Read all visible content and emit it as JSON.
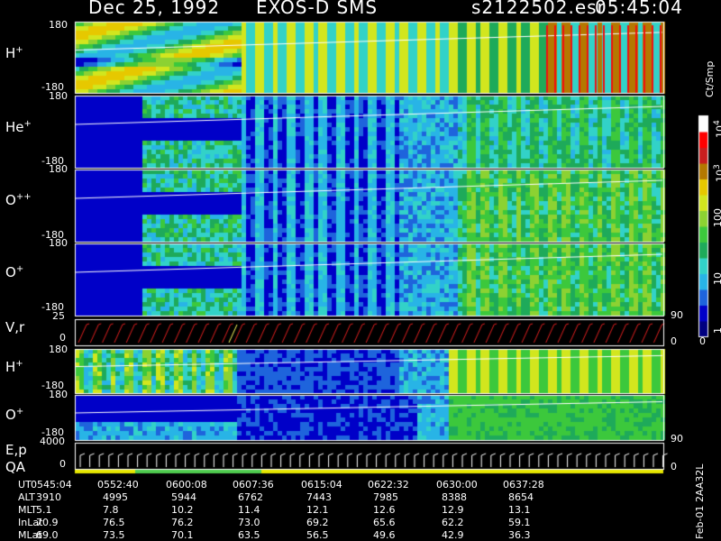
{
  "header": {
    "date": "Dec 25, 1992",
    "instrument": "EXOS-D SMS",
    "filename": "s2122502.esr",
    "time": "05:45:04"
  },
  "colorbar": {
    "unit": "Ct/Smp",
    "ticks": [
      "10",
      "100",
      "1",
      "10",
      "10",
      "1"
    ],
    "exponents": {
      "t3": "3",
      "t4": "4"
    },
    "scale": "log",
    "colors": [
      "#000080",
      "#0000c8",
      "#1e64dc",
      "#28b4e6",
      "#32d2c8",
      "#1eaa5a",
      "#3cc83c",
      "#8cd232",
      "#d2e61e",
      "#e6c800",
      "#b47800",
      "#c81e1e",
      "#ff0000",
      "#ffffff"
    ]
  },
  "footer": {
    "code": "Feb-01 2AA32L"
  },
  "chart_data": [
    {
      "type": "heatmap",
      "species": "H",
      "charge": "+",
      "yticks": [
        "180",
        "-180"
      ],
      "note": "pitch angle vs time"
    },
    {
      "type": "heatmap",
      "species": "He",
      "charge": "+",
      "yticks": [
        "180",
        "-180"
      ]
    },
    {
      "type": "heatmap",
      "species": "O",
      "charge": "++",
      "yticks": [
        "180",
        "-180"
      ]
    },
    {
      "type": "heatmap",
      "species": "O",
      "charge": "+",
      "yticks": [
        "180",
        "-180"
      ]
    },
    {
      "type": "line",
      "label": "V,r",
      "yticks": [
        "25",
        "0"
      ],
      "right_ticks": [
        "90",
        "0"
      ]
    },
    {
      "type": "heatmap",
      "species": "H",
      "charge": "+",
      "yticks": [
        "180",
        "-180"
      ]
    },
    {
      "type": "heatmap",
      "species": "O",
      "charge": "+",
      "yticks": [
        "180",
        "-180"
      ],
      "right_ticks": [
        "90"
      ]
    },
    {
      "type": "line",
      "label": "E,p",
      "label2": "QA",
      "yticks": [
        "4000",
        "0"
      ],
      "right_ticks": [
        "0"
      ]
    }
  ],
  "ephemeris": {
    "rows": [
      {
        "name": "UT",
        "values": [
          "0545:04",
          "0552:40",
          "0600:08",
          "0607:36",
          "0615:04",
          "0622:32",
          "0630:00",
          "0637:28"
        ]
      },
      {
        "name": "ALT",
        "values": [
          "3910",
          "4995",
          "5944",
          "6762",
          "7443",
          "7985",
          "8388",
          "8654"
        ]
      },
      {
        "name": "MLT",
        "values": [
          "5.1",
          "7.8",
          "10.2",
          "11.4",
          "12.1",
          "12.6",
          "12.9",
          "13.1"
        ]
      },
      {
        "name": "InLat",
        "values": [
          "70.9",
          "76.5",
          "76.2",
          "73.0",
          "69.2",
          "65.6",
          "62.2",
          "59.1"
        ]
      },
      {
        "name": "MLat",
        "values": [
          "69.0",
          "73.5",
          "70.1",
          "63.5",
          "56.5",
          "49.6",
          "42.9",
          "36.3"
        ]
      }
    ]
  }
}
